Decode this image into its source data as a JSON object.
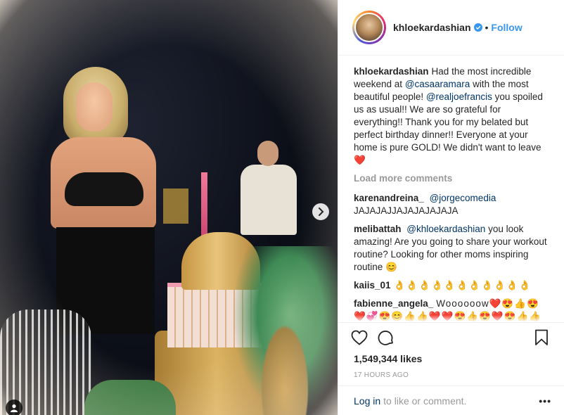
{
  "post": {
    "username": "khloekardashian",
    "follow_label": "Follow",
    "separator": "•"
  },
  "caption": {
    "username": "khloekardashian",
    "parts": [
      "Had the most incredible weekend at ",
      "@casaaramara",
      " with the most beautiful people! ",
      "@realjoefrancis",
      " you spoiled us as usual!! We are so grateful for everything!! Thank you for my belated but perfect birthday dinner!! Everyone at your home is pure GOLD! We didn't want to leave ",
      "❤️"
    ]
  },
  "load_more": "Load more comments",
  "comments": [
    {
      "user": "karenandreina_",
      "mention": "@jorgecomedia",
      "text": "JAJAJAJJAJAJAJAJAJA"
    },
    {
      "user": "melibattah",
      "mention": "@khloekardashian",
      "text": "you look amazing! Are you going to share your workout routine? Looking for other moms inspiring routine 😊"
    },
    {
      "user": "kaiis_01",
      "mention": "",
      "text": "👌👌👌👌👌👌👌👌👌👌👌"
    },
    {
      "user": "fabienne_angela_",
      "mention": "",
      "text": "Woooooow❤️😍👍😍"
    },
    {
      "user": "",
      "mention": "",
      "text": "❤️💞😍😊👍👍❤️❤️😍👍😍❤️😍👍👍"
    },
    {
      "user": "",
      "mention": "",
      "text": "❤️❤️💕❤️😍👍❤️❤️❤️😍😍❤️😍"
    }
  ],
  "stats": {
    "likes": "1,549,344 likes",
    "time": "17 HOURS AGO"
  },
  "footer": {
    "login": "Log in",
    "rest": "to like or comment.",
    "more": "•••"
  },
  "colors": {
    "link_blue": "#3897f0",
    "mention_blue": "#003569",
    "muted": "#999999"
  },
  "icons": {
    "verified": "verified-badge-icon",
    "like": "heart-outline-icon",
    "comment": "comment-bubble-icon",
    "save": "bookmark-icon",
    "next": "chevron-right-icon",
    "tag": "user-tag-icon"
  }
}
